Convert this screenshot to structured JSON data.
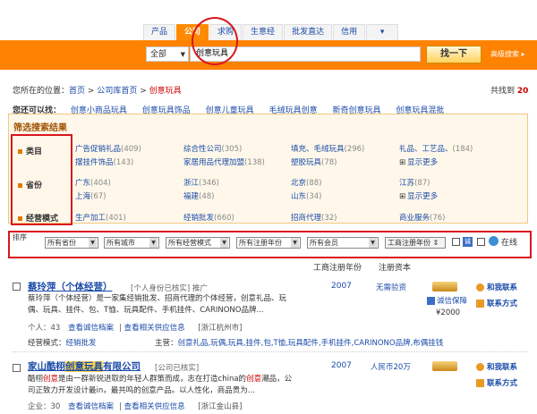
{
  "tabs": [
    {
      "label": "产品"
    },
    {
      "label": "公司"
    },
    {
      "label": "求购"
    },
    {
      "label": "生意经"
    },
    {
      "label": "批发直达"
    },
    {
      "label": "信用"
    },
    {
      "label": "▾"
    }
  ],
  "search": {
    "category": "全部",
    "query": "创意玩具",
    "button": "找一下",
    "advanced": "高级搜索 ▸"
  },
  "breadcrumb": {
    "prefix": "您所在的位置：",
    "home": "首页",
    "company_home": "公司库首页",
    "current": "创意玩具",
    "sep": ">"
  },
  "found": {
    "text": "共找到",
    "count": "20"
  },
  "suggest": {
    "label": "您还可以找：",
    "items": [
      "创意小商品玩具",
      "创意玩具饰品",
      "创意儿童玩具",
      "毛绒玩具创意",
      "新奇创意玩具",
      "创意玩具混批"
    ]
  },
  "filter": {
    "title": "筛选搜索结果",
    "rows": [
      {
        "label": "类目",
        "items": [
          {
            "name": "广告促销礼品",
            "count": "(409)"
          },
          {
            "name": "综合性公司",
            "count": "(305)"
          },
          {
            "name": "填充、毛绒玩具",
            "count": "(296)"
          },
          {
            "name": "礼品、工艺品、",
            "count": "(184)"
          },
          {
            "name": "摆挂件饰品",
            "count": "(143)"
          },
          {
            "name": "家居用品代理加盟",
            "count": "(138)"
          },
          {
            "name": "塑胶玩具",
            "count": "(78)"
          }
        ],
        "more": "显示更多"
      },
      {
        "label": "省份",
        "items": [
          {
            "name": "广东",
            "count": "(404)"
          },
          {
            "name": "浙江",
            "count": "(346)"
          },
          {
            "name": "北京",
            "count": "(88)"
          },
          {
            "name": "江苏",
            "count": "(87)"
          },
          {
            "name": "上海",
            "count": "(67)"
          },
          {
            "name": "福建",
            "count": "(48)"
          },
          {
            "name": "山东",
            "count": "(34)"
          }
        ],
        "more": "显示更多"
      },
      {
        "label": "经营模式",
        "items": [
          {
            "name": "生产加工",
            "count": "(401)"
          },
          {
            "name": "经销批发",
            "count": "(660)"
          },
          {
            "name": "招商代理",
            "count": "(32)"
          },
          {
            "name": "商业服务",
            "count": "(76)"
          }
        ]
      }
    ]
  },
  "dropdown_row": {
    "label": "排序",
    "selects": [
      "所有省份",
      "所有城市",
      "所有经营模式",
      "所有注册年份",
      "所有会员"
    ],
    "sort_button": "工商注册年份 ⇕",
    "online_label": "在线"
  },
  "columns": {
    "year": "工商注册年份",
    "capital": "注册资本"
  },
  "results": [
    {
      "title": "蔡玲萍（个体经营）",
      "type": "[个人身份已核实]  推广",
      "desc1": "蔡玲萍（个体经营）是一家集经销批发、招商代理的个体经营，创意礼品、玩",
      "desc2": "偶、玩具、挂件、包、T恤、玩具配件、手机挂件、CARINONO品牌...",
      "meta_count": "个人：43",
      "meta_links": [
        "查看诚信档案",
        "查看相关供应信息"
      ],
      "location": "[浙江杭州市]",
      "biz_label": "经营模式：",
      "biz_value": "经销批发",
      "main_label": "主营：",
      "main_value": "创意礼品,玩偶,玩具,挂件,包,T恤,玩具配件,手机挂件,CARINONO品牌,布偶挂钱",
      "year": "2007",
      "capital": "无需验资",
      "trust": "诚信保障",
      "deposit": "¥2000",
      "action1": "和我联系",
      "action2": "联系方式"
    },
    {
      "title_pre": "家山酷栩",
      "title_hl": "创意玩具",
      "title_post": "有限公司",
      "type": "[公司已核实]",
      "desc1_pre": "酷栩",
      "desc1_hl": "创意",
      "desc1_post": "是由一群新锐进取的年轻人群策而成，志在打造china的",
      "desc1_hl2": "创意",
      "desc1_end": "潮品，公",
      "desc2": "司正致力开发设计最in，最共鸣的创意产品。以人性化，商品贵为...",
      "meta_count": "企业：30",
      "meta_links": [
        "查看诚信档案",
        "查看相关供应信息"
      ],
      "location": "[浙江金山县]",
      "year": "2007",
      "capital": "人民币20万",
      "action1": "和我联系",
      "action2": "联系方式"
    }
  ],
  "accent": "#ff8200",
  "annotation_color": "#d9171e"
}
